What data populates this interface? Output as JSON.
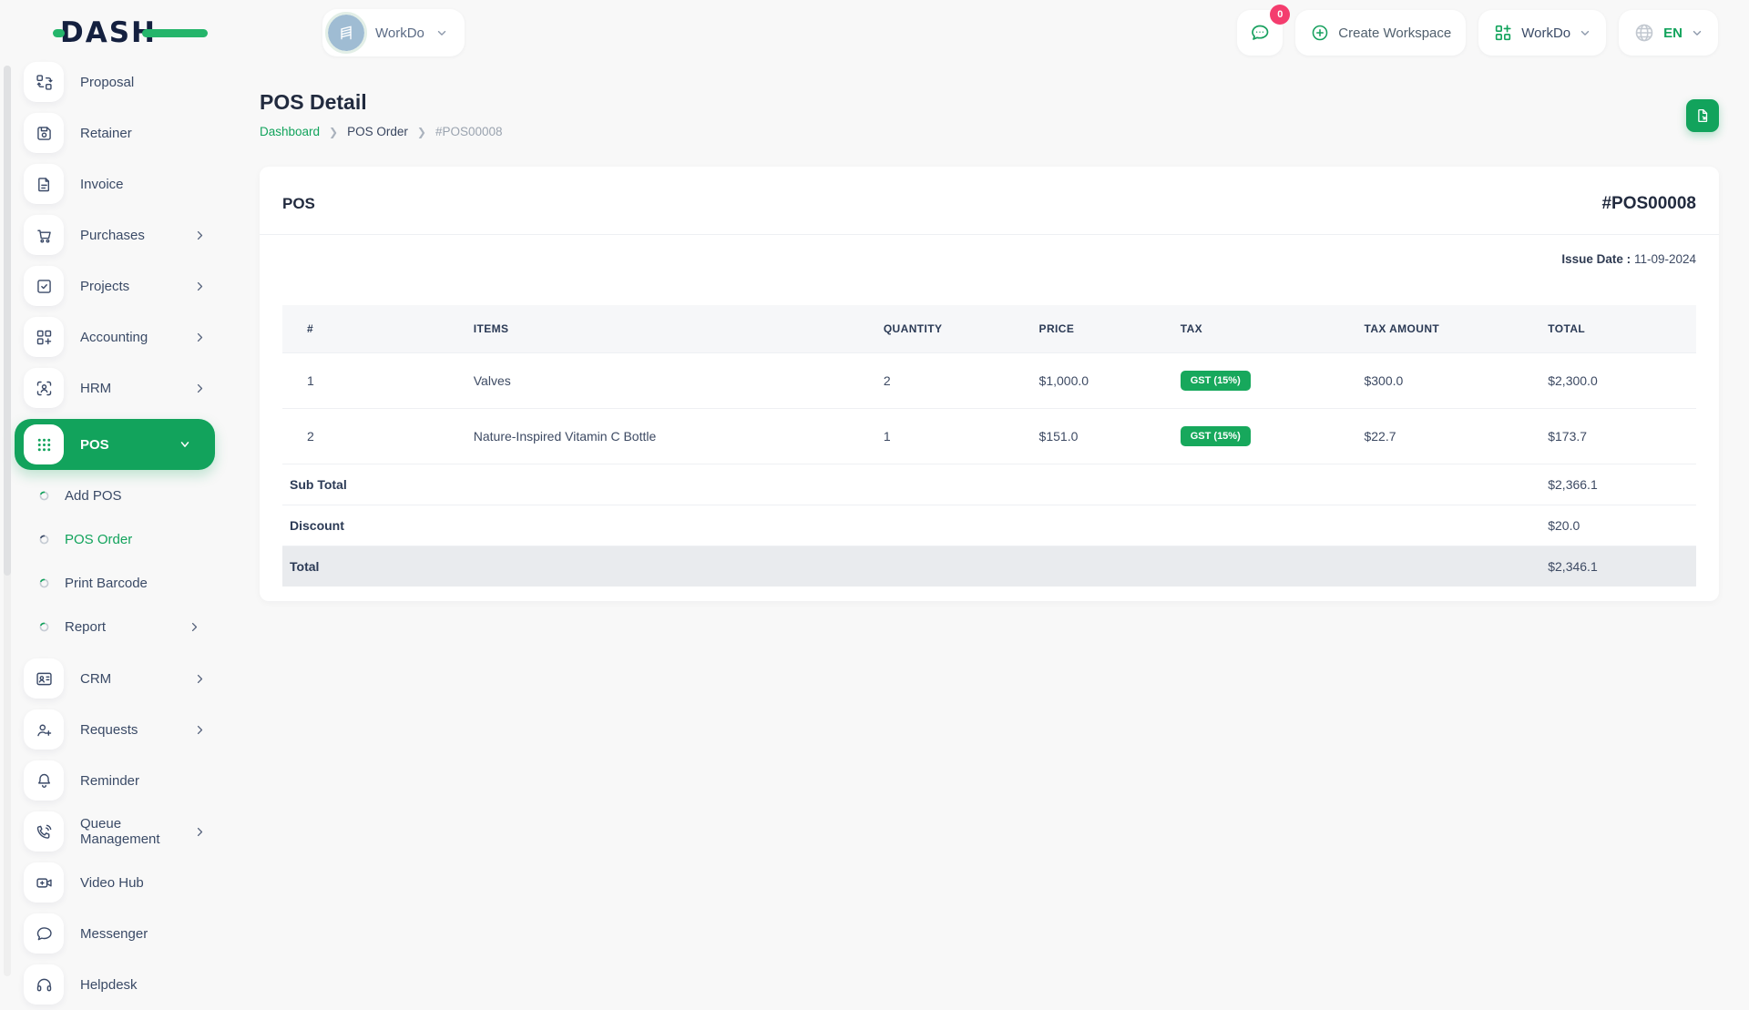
{
  "brand": {
    "name": "DASH"
  },
  "colors": {
    "primary": "#12a35c",
    "navy": "#14203f",
    "badge_pink": "#f43d6e"
  },
  "header": {
    "workspace": {
      "name": "WorkDo"
    },
    "chat_badge": "0",
    "create_workspace": "Create Workspace",
    "app_menu": "WorkDo",
    "language": "EN"
  },
  "sidebar": {
    "items": [
      {
        "label": "Proposal"
      },
      {
        "label": "Retainer"
      },
      {
        "label": "Invoice"
      },
      {
        "label": "Purchases",
        "expandable": true
      },
      {
        "label": "Projects",
        "expandable": true
      },
      {
        "label": "Accounting",
        "expandable": true
      },
      {
        "label": "HRM",
        "expandable": true
      },
      {
        "label": "POS",
        "active": true,
        "expanded": true
      },
      {
        "label": "CRM",
        "expandable": true
      },
      {
        "label": "Requests",
        "expandable": true
      },
      {
        "label": "Reminder"
      },
      {
        "label": "Queue Management",
        "expandable": true
      },
      {
        "label": "Video Hub"
      },
      {
        "label": "Messenger"
      },
      {
        "label": "Helpdesk"
      }
    ],
    "pos_children": [
      {
        "label": "Add POS"
      },
      {
        "label": "POS Order",
        "active": true
      },
      {
        "label": "Print Barcode"
      },
      {
        "label": "Report",
        "expandable": true
      }
    ]
  },
  "page": {
    "title": "POS Detail",
    "breadcrumb": [
      "Dashboard",
      "POS Order",
      "#POS00008"
    ]
  },
  "pos_card": {
    "title": "POS",
    "number": "#POS00008",
    "issue_date_label": "Issue Date :",
    "issue_date": "11-09-2024",
    "table": {
      "headers": [
        "#",
        "ITEMS",
        "QUANTITY",
        "PRICE",
        "TAX",
        "TAX AMOUNT",
        "TOTAL"
      ],
      "rows": [
        {
          "no": "1",
          "item": "Valves",
          "qty": "2",
          "price": "$1,000.0",
          "tax": "GST (15%)",
          "tax_amount": "$300.0",
          "total": "$2,300.0"
        },
        {
          "no": "2",
          "item": "Nature-Inspired Vitamin C Bottle",
          "qty": "1",
          "price": "$151.0",
          "tax": "GST (15%)",
          "tax_amount": "$22.7",
          "total": "$173.7"
        }
      ],
      "summary": [
        {
          "label": "Sub Total",
          "value": "$2,366.1"
        },
        {
          "label": "Discount",
          "value": "$20.0"
        },
        {
          "label": "Total",
          "value": "$2,346.1",
          "highlight": true
        }
      ]
    }
  }
}
